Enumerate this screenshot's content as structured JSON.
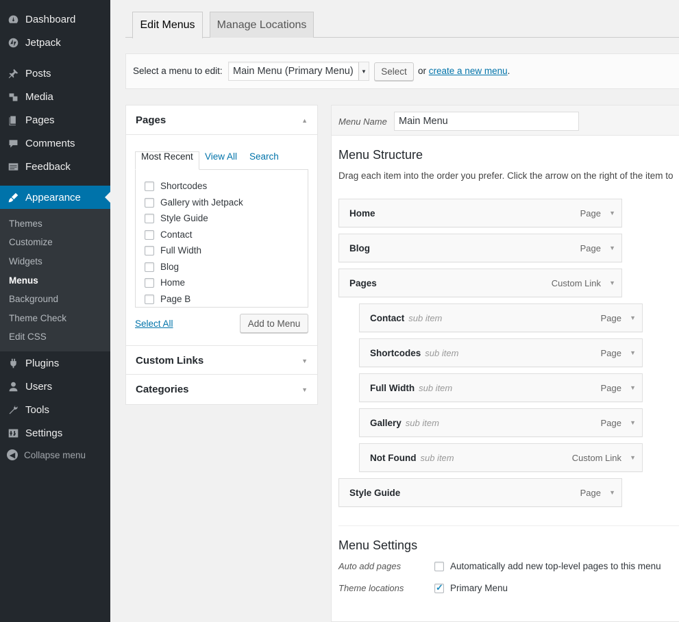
{
  "sidebar": {
    "top": [
      {
        "label": "Dashboard",
        "icon": "dashboard-icon"
      },
      {
        "label": "Jetpack",
        "icon": "jetpack-icon"
      }
    ],
    "items": [
      {
        "label": "Posts",
        "icon": "pin-icon"
      },
      {
        "label": "Media",
        "icon": "media-icon"
      },
      {
        "label": "Pages",
        "icon": "pages-icon"
      },
      {
        "label": "Comments",
        "icon": "comment-icon"
      },
      {
        "label": "Feedback",
        "icon": "feedback-icon"
      }
    ],
    "appearance": {
      "label": "Appearance",
      "icon": "paintbrush-icon"
    },
    "submenu": [
      "Themes",
      "Customize",
      "Widgets",
      "Menus",
      "Background",
      "Theme Check",
      "Edit CSS"
    ],
    "lower": [
      {
        "label": "Plugins",
        "icon": "plugin-icon"
      },
      {
        "label": "Users",
        "icon": "users-icon"
      },
      {
        "label": "Tools",
        "icon": "wrench-icon"
      },
      {
        "label": "Settings",
        "icon": "settings-icon"
      }
    ],
    "collapse": "Collapse menu",
    "active_color": "#0073aa"
  },
  "tabs": {
    "edit": "Edit Menus",
    "manage": "Manage Locations"
  },
  "selector": {
    "label": "Select a menu to edit:",
    "value": "Main Menu (Primary Menu)",
    "button": "Select",
    "or": "or",
    "link": "create a new menu",
    "period": "."
  },
  "left": {
    "pages_title": "Pages",
    "page_tabs": [
      "Most Recent",
      "View All",
      "Search"
    ],
    "pages": [
      "Shortcodes",
      "Gallery with Jetpack",
      "Style Guide",
      "Contact",
      "Full Width",
      "Blog",
      "Home",
      "Page B"
    ],
    "select_all": "Select All",
    "add_button": "Add to Menu",
    "custom_links": "Custom Links",
    "categories": "Categories"
  },
  "menu": {
    "name_label": "Menu Name",
    "name_value": "Main Menu",
    "structure_title": "Menu Structure",
    "structure_desc": "Drag each item into the order you prefer. Click the arrow on the right of the item to",
    "sub_label": "sub item",
    "items": [
      {
        "title": "Home",
        "type": "Page",
        "sub": false
      },
      {
        "title": "Blog",
        "type": "Page",
        "sub": false
      },
      {
        "title": "Pages",
        "type": "Custom Link",
        "sub": false
      },
      {
        "title": "Contact",
        "type": "Page",
        "sub": true
      },
      {
        "title": "Shortcodes",
        "type": "Page",
        "sub": true
      },
      {
        "title": "Full Width",
        "type": "Page",
        "sub": true
      },
      {
        "title": "Gallery",
        "type": "Page",
        "sub": true
      },
      {
        "title": "Not Found",
        "type": "Custom Link",
        "sub": true
      },
      {
        "title": "Style Guide",
        "type": "Page",
        "sub": false
      }
    ],
    "settings_title": "Menu Settings",
    "auto_add_label": "Auto add pages",
    "auto_add_text": "Automatically add new top-level pages to this menu",
    "auto_add_checked": false,
    "locations_label": "Theme locations",
    "primary_text": "Primary Menu",
    "primary_checked": true
  }
}
